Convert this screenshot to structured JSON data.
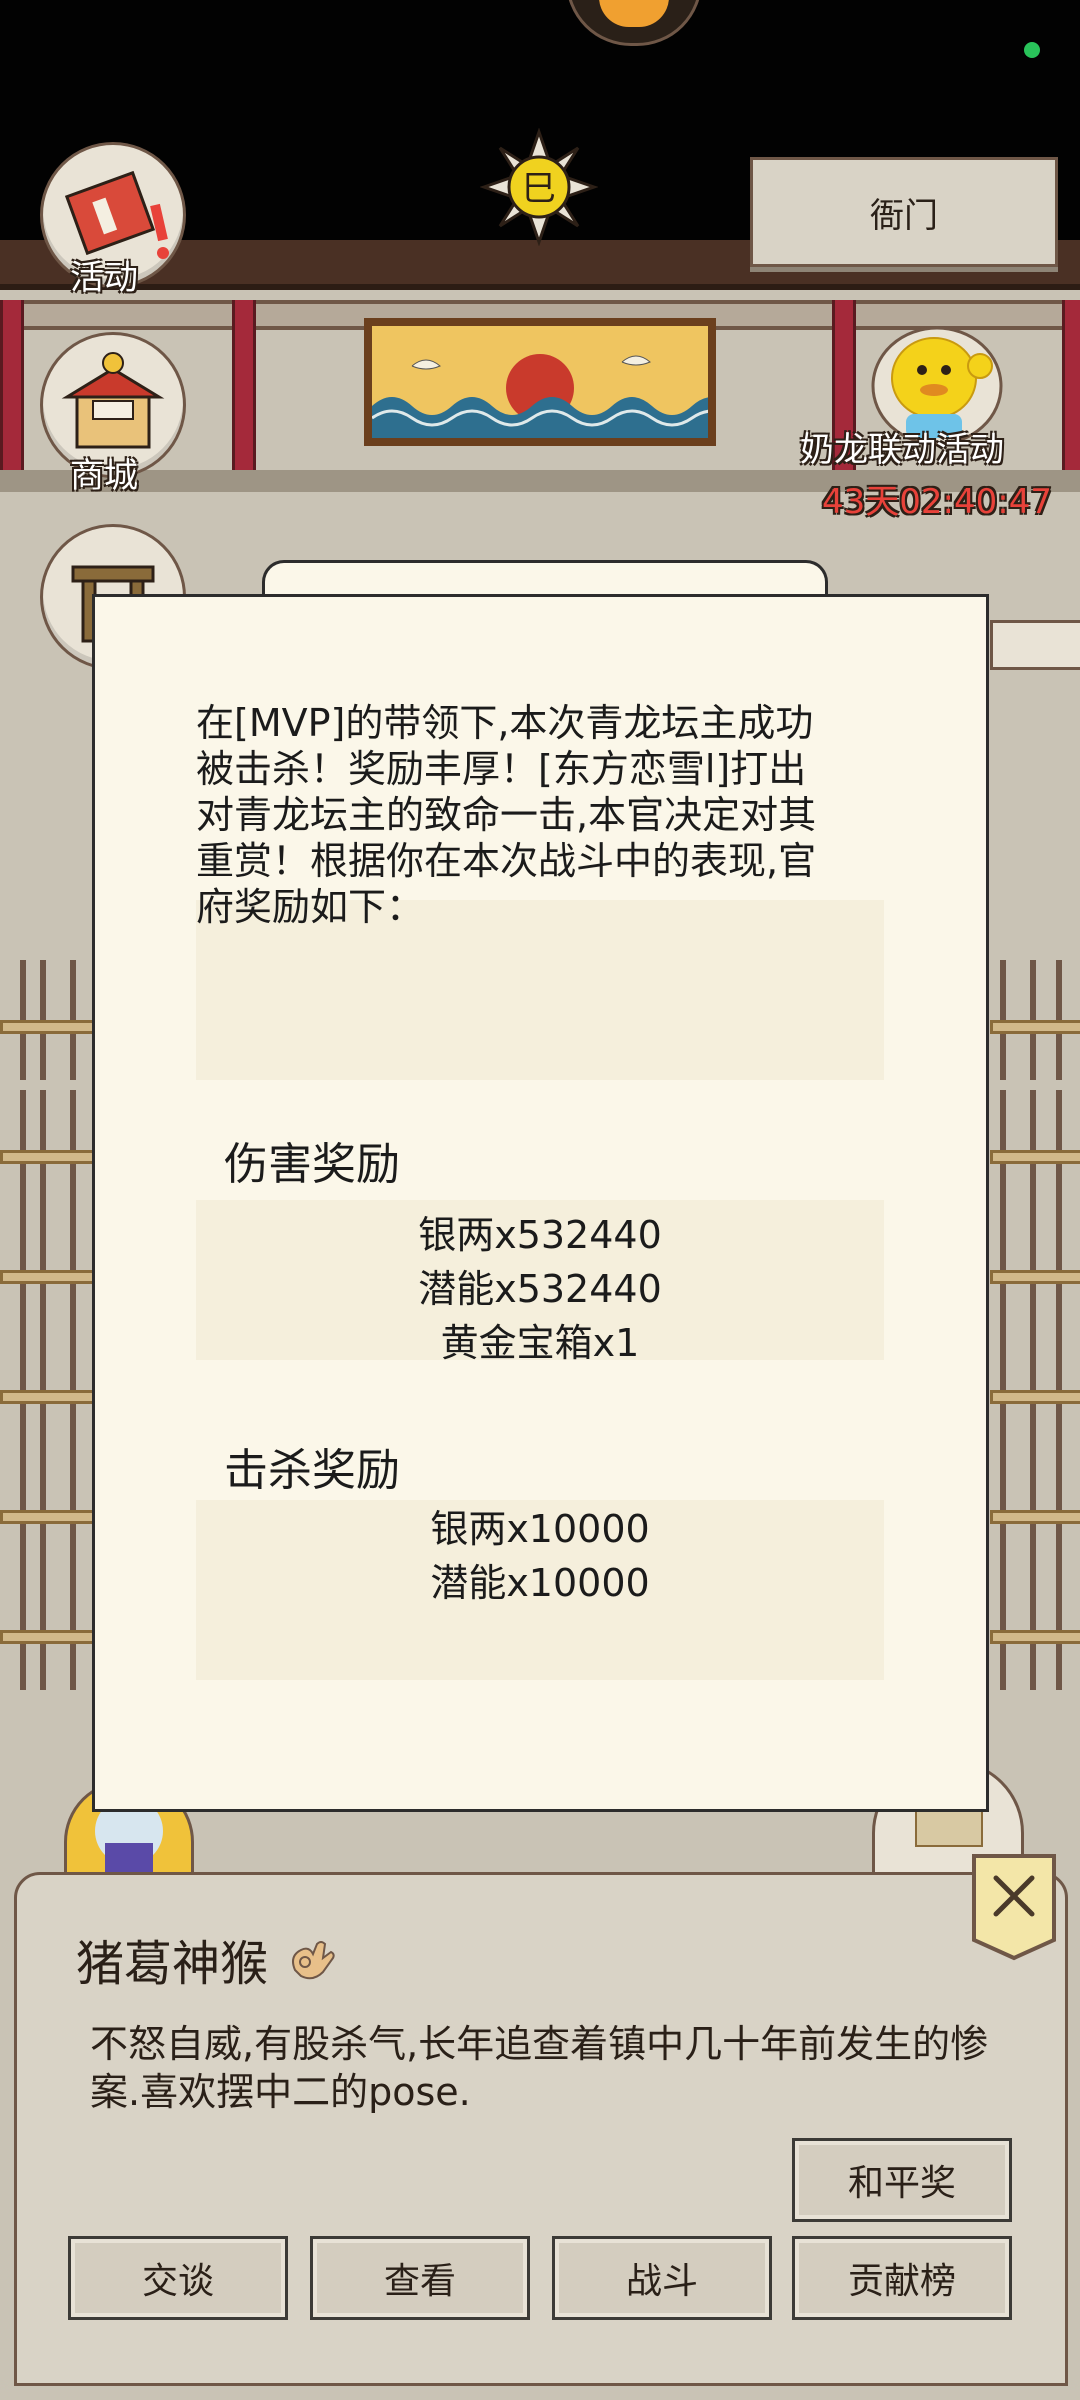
{
  "hud": {
    "activity_label": "活动",
    "shop_label": "商城",
    "yamen_button": "衙门",
    "event_name": "奶龙联动活动",
    "event_timer": "43天02:40:47"
  },
  "reward_dialog": {
    "message": "在[MVP]的带领下,本次青龙坛主成功\n被击杀！奖励丰厚！[东方恋雪l]打出\n对青龙坛主的致命一击,本官决定对其\n重赏！根据你在本次战斗中的表现,官\n府奖励如下：",
    "damage_title": "伤害奖励",
    "damage_rewards": [
      "银两x532440",
      "潜能x532440",
      "黄金宝箱x1"
    ],
    "kill_title": "击杀奖励",
    "kill_rewards": [
      "银两x10000",
      "潜能x10000"
    ]
  },
  "npc_panel": {
    "name": "猪葛神猴",
    "description": "不怒自威,有股杀气,长年追查着镇中几十年前发生的惨案.喜欢摆中二的pose.",
    "buttons": {
      "peace": "和平奖",
      "talk": "交谈",
      "view": "查看",
      "fight": "战斗",
      "ranking": "贡献榜"
    }
  },
  "colors": {
    "accent_red": "#e8423a",
    "dialog_bg": "#fbf7e9",
    "panel_bg": "#d9d3c6"
  }
}
